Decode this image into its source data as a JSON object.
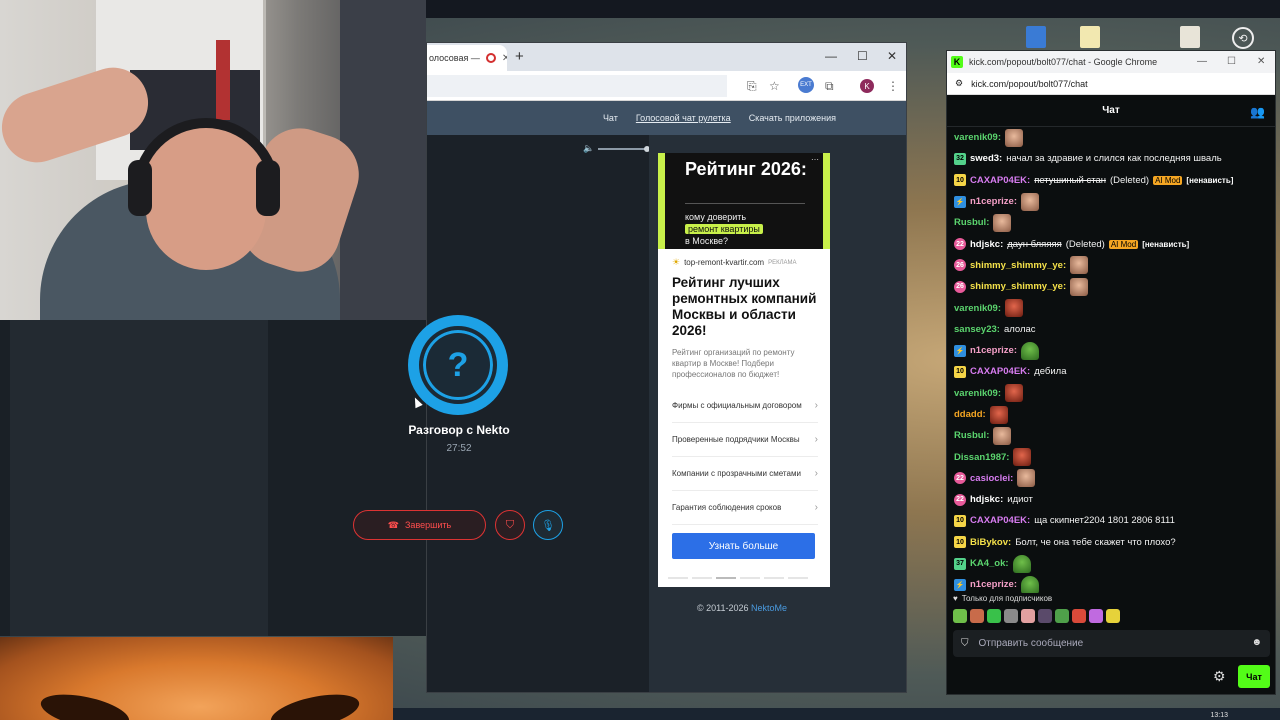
{
  "browser": {
    "tab_title": "олосовая —",
    "new_tab_symbol": "+",
    "controls": {
      "minimize": "—",
      "maximize": "☐",
      "close": "✕"
    },
    "avatar_letter": "K"
  },
  "site": {
    "nav": [
      "Чат",
      "Голосовой чат рулетка",
      "Скачать приложения"
    ],
    "call": {
      "title": "Разговор с Nekto",
      "timer": "27:52",
      "end_label": "Завершить",
      "avatar_symbol": "?"
    },
    "copyright_prefix": "© 2011-2026",
    "copyright_link": "NektoMe"
  },
  "ad": {
    "banner_title": "Рейтинг 2026:",
    "banner_sub_1": "кому доверить",
    "banner_highlight": "ремонт квартиры",
    "banner_sub_2": "в Москве?",
    "domain": "top-remont-kvartir.com",
    "badge": "РЕКЛАМА",
    "headline": "Рейтинг лучших ремонтных компаний Москвы и области 2026!",
    "description": "Рейтинг организаций по ремонту квартир в Москве! Подбери профессионалов по бюджет!",
    "links": [
      "Фирмы с официальным договором",
      "Проверенные подрядчики Москвы",
      "Компании с прозрачными сметами",
      "Гарантия соблюдения сроков"
    ],
    "button": "Узнать больше"
  },
  "chat": {
    "window_title": "kick.com/popout/bolt077/chat - Google Chrome",
    "url": "kick.com/popout/bolt077/chat",
    "header": "Чат",
    "messages": [
      {
        "badge": "",
        "badge_class": "",
        "user": "varenik09:",
        "color": "#5bd46e",
        "text": "",
        "emote": "em-face"
      },
      {
        "badge": "32",
        "badge_class": "b-green",
        "user": "swed3:",
        "color": "#ffffff",
        "text": "начал за здравие и слился как последняя шваль",
        "emote": ""
      },
      {
        "badge": "10",
        "badge_class": "b-yellow",
        "user": "CAXAP04EK:",
        "color": "#d77cf0",
        "text": "петушиный стан",
        "strike": true,
        "deleted": "(Deleted)",
        "mod": "AI Mod",
        "tag": "[ненависть]",
        "emote": ""
      },
      {
        "badge": "⚡",
        "badge_class": "b-blue",
        "user": "n1ceprize:",
        "color": "#f5a0c8",
        "text": "",
        "emote": "em-face"
      },
      {
        "badge": "",
        "badge_class": "",
        "user": "Rusbul:",
        "color": "#5bd46e",
        "text": "",
        "emote": "em-face"
      },
      {
        "badge": "22",
        "badge_class": "b-pink",
        "user": "hdjskc:",
        "color": "#ffffff",
        "text": "даун бляяяя",
        "strike": true,
        "deleted": "(Deleted)",
        "mod": "AI Mod",
        "tag": "[ненависть]",
        "emote": ""
      },
      {
        "badge": "26",
        "badge_class": "b-pink",
        "user": "shimmy_shimmy_ye:",
        "color": "#f5e14a",
        "text": "",
        "emote": "em-face"
      },
      {
        "badge": "26",
        "badge_class": "b-pink",
        "user": "shimmy_shimmy_ye:",
        "color": "#f5e14a",
        "text": "",
        "emote": "em-face"
      },
      {
        "badge": "",
        "badge_class": "",
        "user": "varenik09:",
        "color": "#5bd46e",
        "text": "",
        "emote": "em-red"
      },
      {
        "badge": "",
        "badge_class": "",
        "user": "sansey23:",
        "color": "#5bd46e",
        "text": "алолас",
        "emote": ""
      },
      {
        "badge": "⚡",
        "badge_class": "b-blue",
        "user": "n1ceprize:",
        "color": "#f5a0c8",
        "text": "",
        "emote": "em-pepe"
      },
      {
        "badge": "10",
        "badge_class": "b-yellow",
        "user": "CAXAP04EK:",
        "color": "#d77cf0",
        "text": "дебила",
        "emote": ""
      },
      {
        "badge": "",
        "badge_class": "",
        "user": "varenik09:",
        "color": "#5bd46e",
        "text": "",
        "emote": "em-red"
      },
      {
        "badge": "",
        "badge_class": "",
        "user": "ddadd:",
        "color": "#f5a623",
        "text": "",
        "emote": "em-red"
      },
      {
        "badge": "",
        "badge_class": "",
        "user": "Rusbul:",
        "color": "#5bd46e",
        "text": "",
        "emote": "em-face"
      },
      {
        "badge": "",
        "badge_class": "",
        "user": "Dissan1987:",
        "color": "#5bd46e",
        "text": "",
        "emote": "em-red"
      },
      {
        "badge": "22",
        "badge_class": "b-pink",
        "user": "casioclei:",
        "color": "#d77cf0",
        "text": "",
        "emote": "em-face"
      },
      {
        "badge": "22",
        "badge_class": "b-pink",
        "user": "hdjskc:",
        "color": "#ffffff",
        "text": "идиот",
        "emote": ""
      },
      {
        "badge": "10",
        "badge_class": "b-yellow",
        "user": "CAXAP04EK:",
        "color": "#d77cf0",
        "text": "ща скипнет2204 1801 2806 8111",
        "emote": ""
      },
      {
        "badge": "10",
        "badge_class": "b-yellow",
        "user": "BiBykov:",
        "color": "#f5e14a",
        "text": "Болт, че она тебе скажет что плохо?",
        "emote": ""
      },
      {
        "badge": "37",
        "badge_class": "b-green",
        "user": "KA4_ok:",
        "color": "#5bd46e",
        "text": "",
        "emote": "em-pepe"
      },
      {
        "badge": "⚡",
        "badge_class": "b-blue",
        "user": "n1ceprize:",
        "color": "#f5a0c8",
        "text": "",
        "emote": "em-pepe"
      }
    ],
    "subs_only": "Только для подписчиков",
    "input_placeholder": "Отправить сообщение",
    "send_label": "Чат"
  },
  "taskbar": {
    "clock": "13:13"
  }
}
